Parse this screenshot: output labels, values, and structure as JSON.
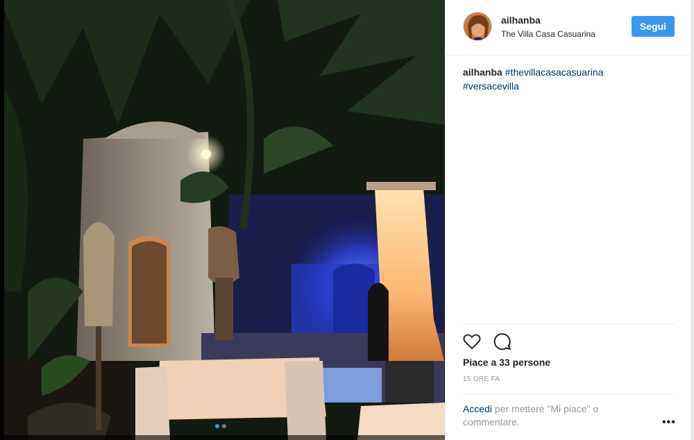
{
  "post": {
    "username": "ailhanba",
    "location": "The Villa Casa Casuarina",
    "follow_label": "Segui",
    "caption": {
      "username": "ailhanba",
      "hashtags": [
        "#thevillacasacasuarina",
        "#versacevilla"
      ]
    },
    "likes_text": "Piace a 33 persone",
    "timestamp": "15 ORE FA",
    "login_prompt": {
      "link_text": "Accedi",
      "rest_text": "per mettere \"Mi piace\" o commentare."
    },
    "more_label": "•••"
  },
  "carousel": {
    "count": 2,
    "active_index": 0
  },
  "icons": {
    "like": "heart-icon",
    "comment": "comment-bubble-icon",
    "more": "more-options-icon"
  },
  "colors": {
    "accent": "#3897f0",
    "hashtag": "#003569",
    "muted": "#999999"
  }
}
